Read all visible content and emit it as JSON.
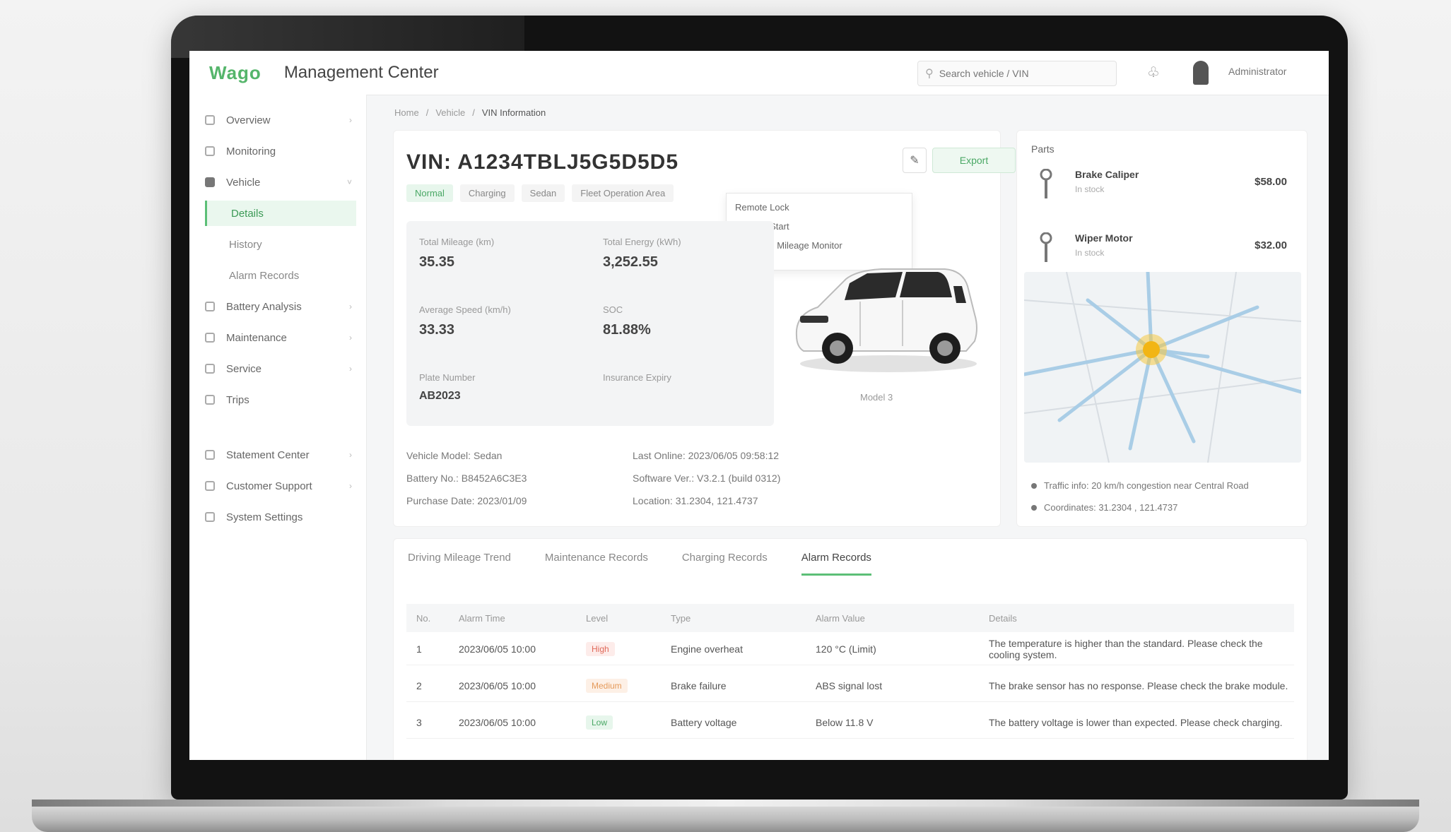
{
  "header": {
    "logo": "Wago",
    "title": "Management Center",
    "search_placeholder": "Search vehicle / VIN",
    "username": "Administrator"
  },
  "sidebar": {
    "items": [
      {
        "label": "Overview",
        "icon": "square-icon"
      },
      {
        "label": "Monitoring",
        "icon": "square-icon"
      },
      {
        "label": "Vehicle",
        "icon": "square-icon",
        "open": true
      }
    ],
    "subitems": [
      {
        "label": "Details",
        "active": true
      },
      {
        "label": "History",
        "active": false
      },
      {
        "label": "Alarm Records",
        "active": false
      }
    ],
    "items2": [
      {
        "label": "Battery Analysis",
        "icon": "square-icon"
      },
      {
        "label": "Maintenance",
        "icon": "square-icon"
      },
      {
        "label": "Service",
        "icon": "square-icon"
      },
      {
        "label": "Trips",
        "icon": "square-icon"
      }
    ],
    "items3": [
      {
        "label": "Statement Center",
        "icon": "square-icon"
      },
      {
        "label": "Customer Support",
        "icon": "square-icon"
      },
      {
        "label": "System Settings",
        "icon": "square-icon"
      }
    ]
  },
  "breadcrumb": [
    "Home",
    "Vehicle",
    "VIN Information"
  ],
  "vehicle": {
    "vin": "VIN: A1234TBLJ5G5D5D5",
    "action_label": "Export",
    "tags": [
      "Normal",
      "Charging",
      "Sedan",
      "Fleet Operation Area"
    ],
    "dropdown": [
      "Remote Lock",
      "Remote Start",
      "Real-time Mileage Monitor"
    ],
    "metrics": [
      {
        "label": "Total Mileage (km)",
        "value": "35.35"
      },
      {
        "label": "Total Energy (kWh)",
        "value": "3,252.55"
      },
      {
        "label": "Average Speed (km/h)",
        "value": "33.33"
      },
      {
        "label": "SOC",
        "value": "81.88&#37;"
      },
      {
        "label": "Plate Number",
        "value": "AB2023"
      },
      {
        "label": "Insurance Expiry",
        "value": ""
      }
    ],
    "car_caption": "Model 3",
    "info": [
      [
        "Vehicle Model: Sedan",
        "Last Online: 2023/06/05 09:58:12"
      ],
      [
        "Battery No.: B8452A6C3E3",
        "Software Ver.: V3.2.1 (build 0312)"
      ],
      [
        "Purchase Date: 2023/01/09",
        "Location: 31.2304, 121.4737"
      ]
    ]
  },
  "right_panel": {
    "title": "Parts",
    "items": [
      {
        "name": "Brake Caliper",
        "sub": "In stock",
        "price": "$58.00"
      },
      {
        "name": "Wiper Motor",
        "sub": "In stock",
        "price": "$32.00"
      }
    ],
    "lines": [
      "Traffic info: 20 km/h congestion near Central Road",
      "Coordinates: 31.2304 , 121.4737"
    ]
  },
  "bottom": {
    "tabs": [
      {
        "label": "Driving Mileage Trend",
        "active": false
      },
      {
        "label": "Maintenance Records",
        "active": false
      },
      {
        "label": "Charging Records",
        "active": false
      },
      {
        "label": "Alarm Records",
        "active": true
      }
    ],
    "columns": [
      "No.",
      "Alarm Time",
      "Level",
      "Type",
      "Alarm Value",
      "Details"
    ],
    "rows": [
      {
        "no": "1",
        "time": "2023/06/05 10:00",
        "level": "High",
        "level_color": "red",
        "type": "Engine overheat",
        "value": "120 &#176;C (Limit)",
        "details": "The temperature is higher than the standard. Please check the cooling system."
      },
      {
        "no": "2",
        "time": "2023/06/05 10:00",
        "level": "Medium",
        "level_color": "orange",
        "type": "Brake failure",
        "value": "ABS signal lost",
        "details": "The brake sensor has no response. Please check the brake module."
      },
      {
        "no": "3",
        "time": "2023/06/05 10:00",
        "level": "Low",
        "level_color": "green",
        "type": "Battery voltage",
        "value": "Below 11.8 V",
        "details": "The battery voltage is lower than expected. Please check charging."
      }
    ]
  },
  "colors": {
    "accent": "#5cbf77",
    "danger": "#e06a5a",
    "warning": "#e59a5a"
  }
}
